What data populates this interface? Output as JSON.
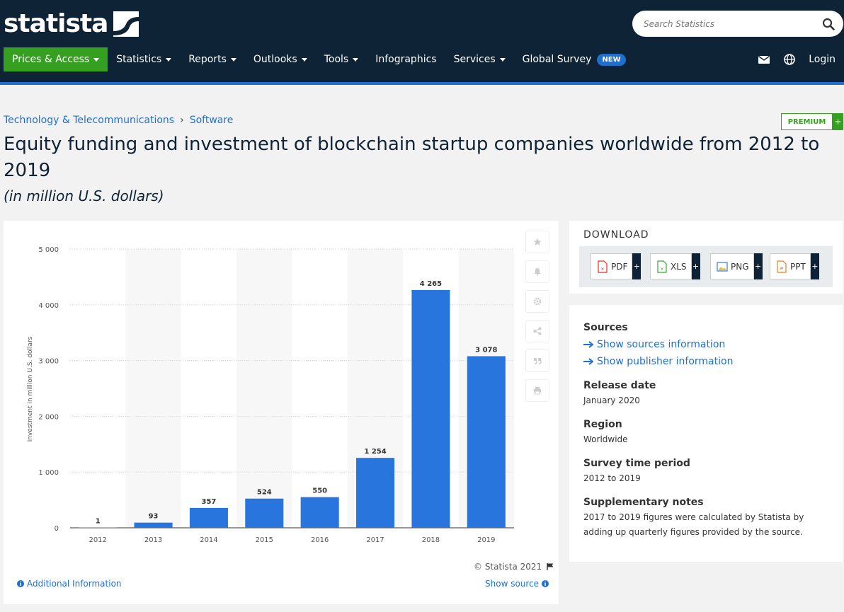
{
  "header": {
    "logo_text": "statista",
    "search_placeholder": "Search Statistics",
    "nav": [
      {
        "label": "Prices & Access",
        "caret": true,
        "active": true
      },
      {
        "label": "Statistics",
        "caret": true
      },
      {
        "label": "Reports",
        "caret": true
      },
      {
        "label": "Outlooks",
        "caret": true
      },
      {
        "label": "Tools",
        "caret": true
      },
      {
        "label": "Infographics",
        "caret": false
      },
      {
        "label": "Services",
        "caret": true
      },
      {
        "label": "Global Survey",
        "caret": false,
        "badge": "NEW"
      }
    ],
    "login_label": "Login",
    "icons": [
      "envelope-icon",
      "globe-icon"
    ]
  },
  "breadcrumb": {
    "items": [
      "Technology & Telecommunications",
      "Software"
    ],
    "separator": "›"
  },
  "premium": {
    "label": "PREMIUM",
    "plus": "+"
  },
  "page": {
    "title": "Equity funding and investment of blockchain startup companies worldwide from 2012 to 2019",
    "subtitle": "(in million U.S. dollars)"
  },
  "chart_data": {
    "type": "bar",
    "categories": [
      "2012",
      "2013",
      "2014",
      "2015",
      "2016",
      "2017",
      "2018",
      "2019"
    ],
    "values": [
      1,
      93,
      357,
      524,
      550,
      1254,
      4265,
      3078
    ],
    "value_labels": [
      "1",
      "93",
      "357",
      "524",
      "550",
      "1 254",
      "4 265",
      "3 078"
    ],
    "ylabel": "Investment in million U.S. dollars",
    "xlabel": "",
    "ylim": [
      0,
      5000
    ],
    "yticks": [
      0,
      1000,
      2000,
      3000,
      4000,
      5000
    ],
    "ytick_labels": [
      "0",
      "1 000",
      "2 000",
      "3 000",
      "4 000",
      "5 000"
    ],
    "grid": true,
    "bar_color": "#2876dd"
  },
  "chart_footer": {
    "copyright": "© Statista 2021",
    "additional_info": "Additional Information",
    "show_source": "Show source"
  },
  "side_tools": [
    "star-icon",
    "bell-icon",
    "gear-icon",
    "share-icon",
    "quote-icon",
    "print-icon"
  ],
  "download": {
    "title": "DOWNLOAD",
    "formats": [
      {
        "label": "PDF",
        "color": "#d9322a"
      },
      {
        "label": "XLS",
        "color": "#3aa43a"
      },
      {
        "label": "PNG",
        "color": "#3a7bd5"
      },
      {
        "label": "PPT",
        "color": "#e8801f"
      }
    ],
    "plus": "+"
  },
  "info": {
    "sources_label": "Sources",
    "show_sources": "Show sources information",
    "show_publisher": "Show publisher information",
    "release_label": "Release date",
    "release_value": "January 2020",
    "region_label": "Region",
    "region_value": "Worldwide",
    "period_label": "Survey time period",
    "period_value": "2012 to 2019",
    "notes_label": "Supplementary notes",
    "notes_value": "2017 to 2019 figures were calculated by Statista by adding up quarterly figures provided by the source."
  },
  "colors": {
    "header_bg": "#0e2336",
    "accent_green": "#35a020",
    "link_blue": "#1f6fd1"
  }
}
